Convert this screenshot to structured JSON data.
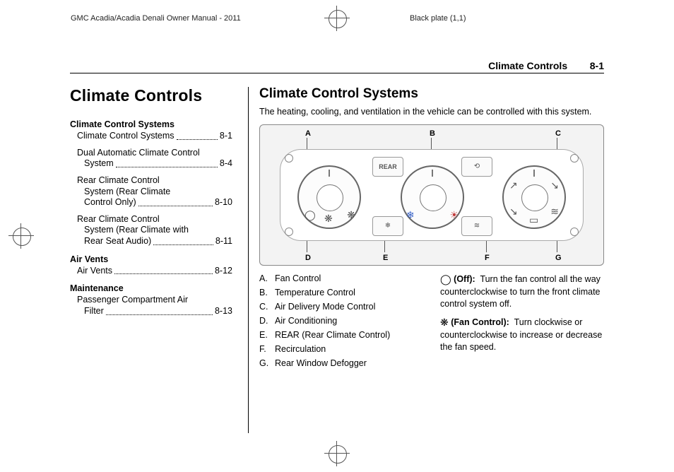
{
  "header": {
    "left": "GMC Acadia/Acadia Denali Owner Manual - 2011",
    "right": "Black plate (1,1)"
  },
  "running_head": {
    "title": "Climate Controls",
    "page": "8-1"
  },
  "chapter_title": "Climate Controls",
  "toc": {
    "groups": [
      {
        "head": "Climate Control Systems",
        "items": [
          {
            "lines": [
              "Climate Control Systems"
            ],
            "page": "8-1"
          },
          {
            "lines": [
              "Dual Automatic Climate Control",
              "System"
            ],
            "page": "8-4"
          },
          {
            "lines": [
              "Rear Climate Control",
              "System (Rear Climate",
              "Control Only)"
            ],
            "page": "8-10"
          },
          {
            "lines": [
              "Rear Climate Control",
              "System (Rear Climate with",
              "Rear Seat Audio)"
            ],
            "page": "8-11"
          }
        ]
      },
      {
        "head": "Air Vents",
        "items": [
          {
            "lines": [
              "Air Vents"
            ],
            "page": "8-12"
          }
        ]
      },
      {
        "head": "Maintenance",
        "items": [
          {
            "lines": [
              "Passenger Compartment Air",
              "Filter"
            ],
            "page": "8-13"
          }
        ]
      }
    ]
  },
  "section_title": "Climate Control Systems",
  "intro": "The heating, cooling, and ventilation in the vehicle can be controlled with this system.",
  "callouts": {
    "A": "A",
    "B": "B",
    "C": "C",
    "D": "D",
    "E": "E",
    "F": "F",
    "G": "G"
  },
  "figure_labels": {
    "rear": "REAR"
  },
  "legend": [
    {
      "k": "A.",
      "v": "Fan Control"
    },
    {
      "k": "B.",
      "v": "Temperature Control"
    },
    {
      "k": "C.",
      "v": "Air Delivery Mode Control"
    },
    {
      "k": "D.",
      "v": "Air Conditioning"
    },
    {
      "k": "E.",
      "v": "REAR (Rear Climate Control)"
    },
    {
      "k": "F.",
      "v": "Recirculation"
    },
    {
      "k": "G.",
      "v": "Rear Window Defogger"
    }
  ],
  "descriptions": {
    "off": {
      "icon": "◯",
      "label": "(Off):",
      "text": "Turn the fan control all the way counterclockwise to turn the front climate control system off."
    },
    "fan": {
      "icon": "❋",
      "label": "(Fan Control):",
      "text": "Turn clockwise or counterclockwise to increase or decrease the fan speed."
    }
  }
}
